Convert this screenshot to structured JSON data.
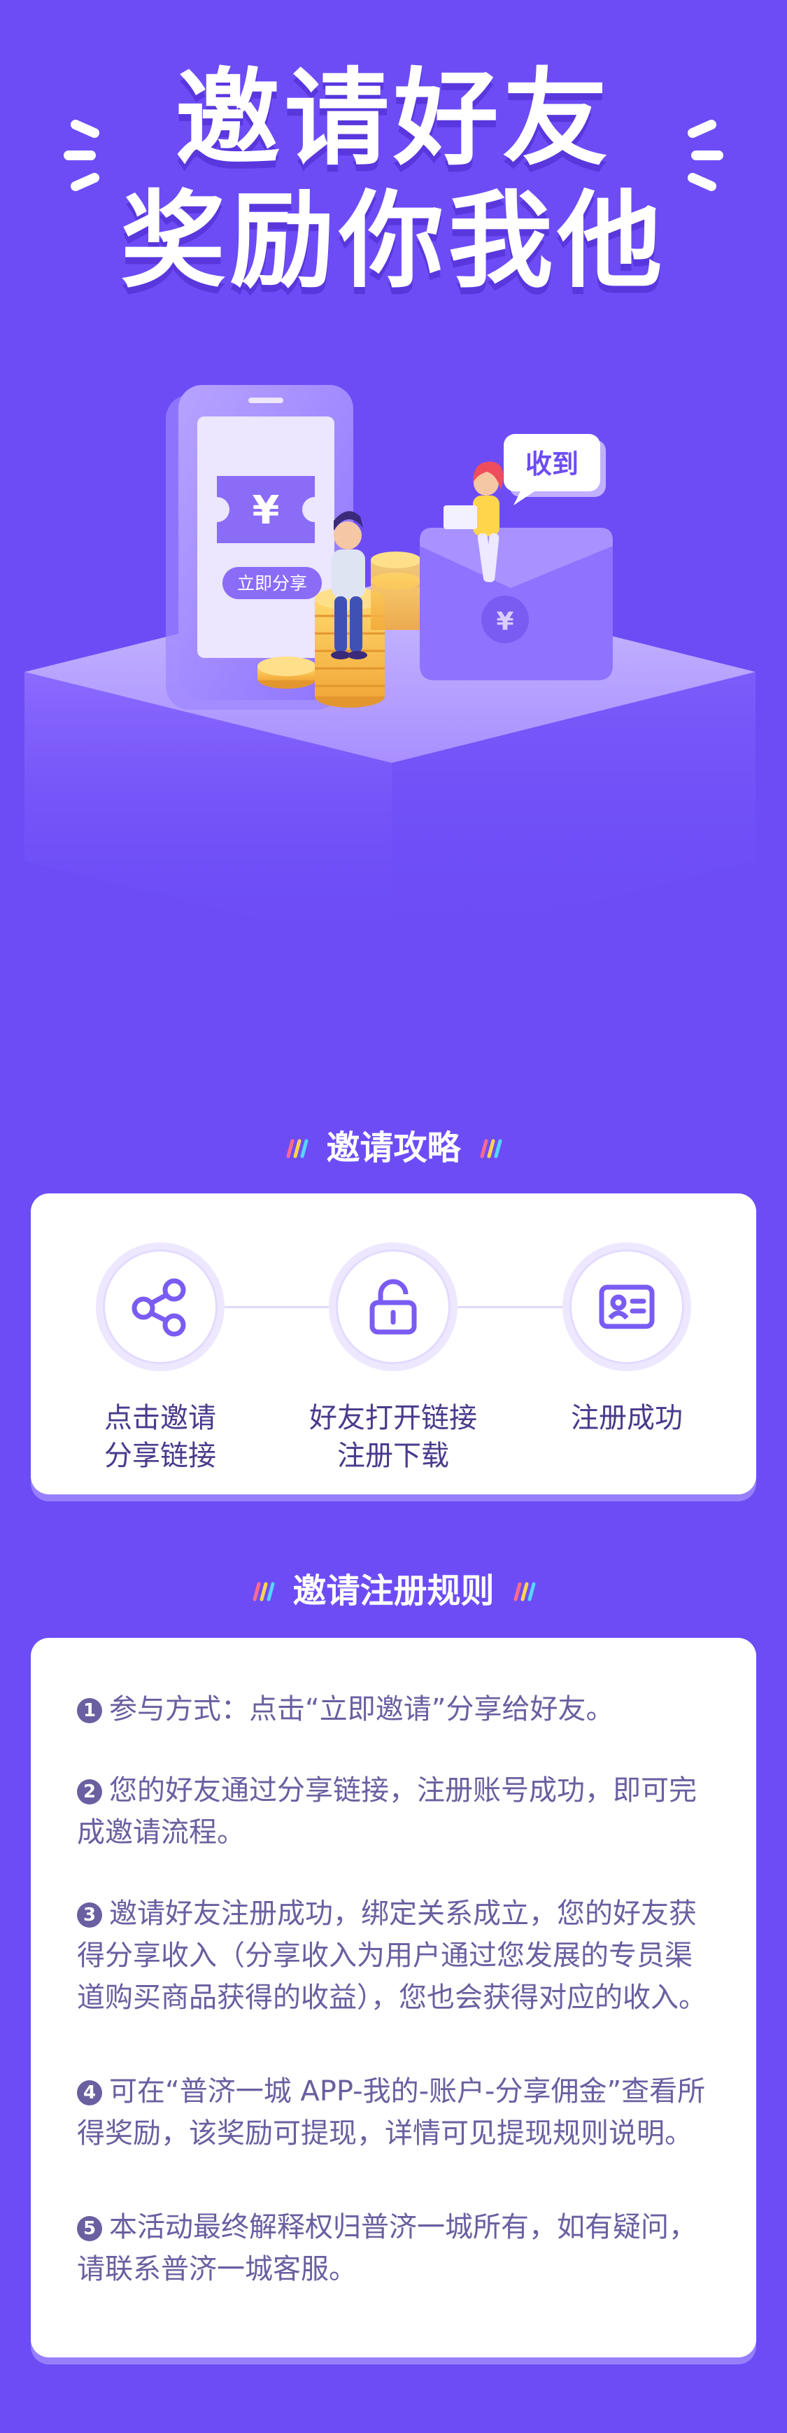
{
  "hero": {
    "title_line1": "邀请好友",
    "title_line2": "奖励你我他",
    "phone_button": "立即分享",
    "bubble_text": "收到",
    "currency_symbol": "¥"
  },
  "strategy": {
    "title": "邀请攻略",
    "steps": [
      {
        "icon": "share-icon",
        "label": "点击邀请\n分享链接"
      },
      {
        "icon": "unlock-icon",
        "label": "好友打开链接\n注册下载"
      },
      {
        "icon": "id-card-icon",
        "label": "注册成功"
      }
    ]
  },
  "rules": {
    "title": "邀请注册规则",
    "items": [
      {
        "num": "1",
        "text": "参与方式：点击“立即邀请”分享给好友。"
      },
      {
        "num": "2",
        "text": "您的好友通过分享链接，注册账号成功，即可完成邀请流程。"
      },
      {
        "num": "3",
        "text": "邀请好友注册成功，绑定关系成立，您的好友获得分享收入（分享收入为用户通过您发展的专员渠道购买商品获得的收益），您也会获得对应的收入。"
      },
      {
        "num": "4",
        "text": "可在“普济一城 APP-我的-账户-分享佣金”查看所得奖励，该奖励可提现，详情可见提现规则说明。"
      },
      {
        "num": "5",
        "text": "本活动最终解释权归普济一城所有，如有疑问，请联系普济一城客服。"
      }
    ]
  },
  "colors": {
    "background": "#6d4cf6",
    "card": "#ffffff",
    "text_dark": "#4a3a8c",
    "text_muted": "#6a5fa0",
    "accent": "#8b6cf7"
  }
}
